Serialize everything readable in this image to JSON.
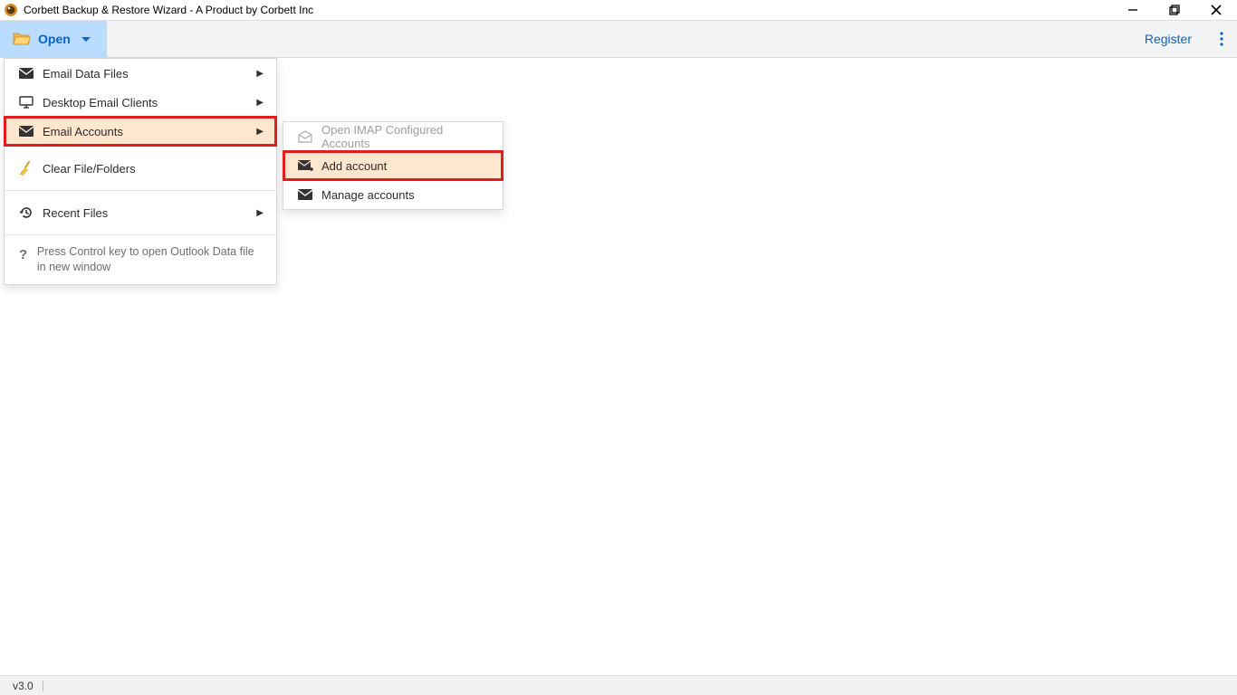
{
  "window": {
    "title": "Corbett Backup & Restore Wizard - A Product by Corbett Inc"
  },
  "toolbar": {
    "open_label": "Open",
    "register_label": "Register"
  },
  "menu": {
    "items": [
      {
        "label": "Email Data Files",
        "icon": "mail-icon",
        "has_submenu": true
      },
      {
        "label": "Desktop Email Clients",
        "icon": "monitor-icon",
        "has_submenu": true
      },
      {
        "label": "Email Accounts",
        "icon": "mail-icon",
        "has_submenu": true,
        "highlighted": true
      },
      {
        "label": "Clear File/Folders",
        "icon": "broom-icon",
        "has_submenu": false
      },
      {
        "label": "Recent Files",
        "icon": "history-icon",
        "has_submenu": true
      }
    ],
    "help_text": "Press Control key to open Outlook Data file in new window"
  },
  "submenu": {
    "items": [
      {
        "label": "Open IMAP Configured Accounts",
        "icon": "mail-open-icon",
        "disabled": true
      },
      {
        "label": "Add account",
        "icon": "mail-add-icon",
        "highlighted": true
      },
      {
        "label": "Manage accounts",
        "icon": "mail-icon"
      }
    ]
  },
  "statusbar": {
    "version": "v3.0"
  }
}
